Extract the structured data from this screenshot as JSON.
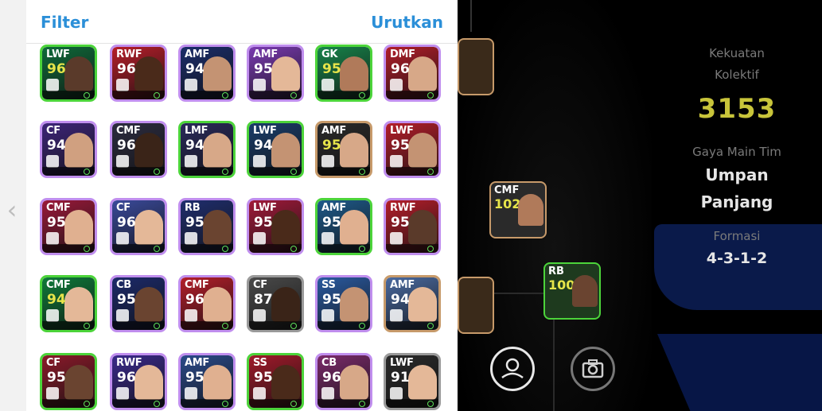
{
  "header": {
    "filter_label": "Filter",
    "sort_label": "Urutkan"
  },
  "players": [
    {
      "pos": "LWF",
      "rating": "96",
      "border": "#4cd43a",
      "bg": "#0f6a3a",
      "rc": "#e6e44a",
      "skin": "#5a3a2a"
    },
    {
      "pos": "RWF",
      "rating": "96",
      "border": "#c08eee",
      "bg": "#b61e2a",
      "rc": "#ffffff",
      "skin": "#4a2a1a"
    },
    {
      "pos": "AMF",
      "rating": "94",
      "border": "#c08eee",
      "bg": "#1b2d6a",
      "rc": "#ffffff",
      "skin": "#c49373"
    },
    {
      "pos": "AMF",
      "rating": "95",
      "border": "#c08eee",
      "bg": "#7a3ab0",
      "rc": "#ffffff",
      "skin": "#e4b898"
    },
    {
      "pos": "GK",
      "rating": "95",
      "border": "#4cd43a",
      "bg": "#17834a",
      "rc": "#e6e44a",
      "skin": "#b07a5a"
    },
    {
      "pos": "DMF",
      "rating": "96",
      "border": "#c08eee",
      "bg": "#b01e2a",
      "rc": "#ffffff",
      "skin": "#d7a888"
    },
    {
      "pos": "CF",
      "rating": "94",
      "border": "#c08eee",
      "bg": "#3d2578",
      "rc": "#ffffff",
      "skin": "#d0a080"
    },
    {
      "pos": "CMF",
      "rating": "96",
      "border": "#c08eee",
      "bg": "#2c2c40",
      "rc": "#ffffff",
      "skin": "#3a2418"
    },
    {
      "pos": "LMF",
      "rating": "94",
      "border": "#4cd43a",
      "bg": "#2a2a5a",
      "rc": "#ffffff",
      "skin": "#d7a888"
    },
    {
      "pos": "LWF",
      "rating": "94",
      "border": "#4cd43a",
      "bg": "#1a3d6a",
      "rc": "#ffffff",
      "skin": "#c49373"
    },
    {
      "pos": "AMF",
      "rating": "95",
      "border": "#c79a6a",
      "bg": "#2a2a2a",
      "rc": "#e6e44a",
      "skin": "#d7a888"
    },
    {
      "pos": "LWF",
      "rating": "95",
      "border": "#c08eee",
      "bg": "#b41e2a",
      "rc": "#ffffff",
      "skin": "#c49373"
    },
    {
      "pos": "CMF",
      "rating": "95",
      "border": "#c08eee",
      "bg": "#9a1a3a",
      "rc": "#ffffff",
      "skin": "#e0b090"
    },
    {
      "pos": "CF",
      "rating": "96",
      "border": "#c08eee",
      "bg": "#3a4a9a",
      "rc": "#ffffff",
      "skin": "#e4b898"
    },
    {
      "pos": "RB",
      "rating": "95",
      "border": "#c08eee",
      "bg": "#1f2e6e",
      "rc": "#ffffff",
      "skin": "#6a4430"
    },
    {
      "pos": "LWF",
      "rating": "95",
      "border": "#c08eee",
      "bg": "#a01a3a",
      "rc": "#ffffff",
      "skin": "#4a2a1a"
    },
    {
      "pos": "AMF",
      "rating": "95",
      "border": "#4cd43a",
      "bg": "#1e5a8a",
      "rc": "#ffffff",
      "skin": "#e0b090"
    },
    {
      "pos": "RWF",
      "rating": "95",
      "border": "#c08eee",
      "bg": "#b41e2a",
      "rc": "#ffffff",
      "skin": "#5a3a2a"
    },
    {
      "pos": "CMF",
      "rating": "94",
      "border": "#4cd43a",
      "bg": "#0f7a3a",
      "rc": "#e6e44a",
      "skin": "#e4b898"
    },
    {
      "pos": "CB",
      "rating": "95",
      "border": "#c08eee",
      "bg": "#1c2a6a",
      "rc": "#ffffff",
      "skin": "#6a4430"
    },
    {
      "pos": "CMF",
      "rating": "96",
      "border": "#c08eee",
      "bg": "#b41e2a",
      "rc": "#ffffff",
      "skin": "#e0b090"
    },
    {
      "pos": "CF",
      "rating": "87",
      "border": "#9a9a9a",
      "bg": "#4a4a4a",
      "rc": "#ffffff",
      "skin": "#3a2418"
    },
    {
      "pos": "SS",
      "rating": "95",
      "border": "#c08eee",
      "bg": "#2a5aa0",
      "rc": "#ffffff",
      "skin": "#c49373"
    },
    {
      "pos": "AMF",
      "rating": "94",
      "border": "#c79a6a",
      "bg": "#4a6aa0",
      "rc": "#ffffff",
      "skin": "#e4b898"
    },
    {
      "pos": "CF",
      "rating": "95",
      "border": "#4cd43a",
      "bg": "#8a1a2a",
      "rc": "#ffffff",
      "skin": "#6a4430"
    },
    {
      "pos": "RWF",
      "rating": "96",
      "border": "#c08eee",
      "bg": "#3a2a8a",
      "rc": "#ffffff",
      "skin": "#e4b898"
    },
    {
      "pos": "AMF",
      "rating": "95",
      "border": "#c08eee",
      "bg": "#2a4a8a",
      "rc": "#ffffff",
      "skin": "#e0b090"
    },
    {
      "pos": "SS",
      "rating": "95",
      "border": "#4cd43a",
      "bg": "#a01a2a",
      "rc": "#ffffff",
      "skin": "#4a2a1a"
    },
    {
      "pos": "CB",
      "rating": "96",
      "border": "#c08eee",
      "bg": "#7a2a6a",
      "rc": "#ffffff",
      "skin": "#d7a888"
    },
    {
      "pos": "LWF",
      "rating": "91",
      "border": "#9a9a9a",
      "bg": "#2a2a2a",
      "rc": "#ffffff",
      "skin": "#e4b898"
    }
  ],
  "pitch_cards": [
    {
      "pos": "CMF",
      "rating": "102",
      "border": "#c79a6a"
    },
    {
      "pos": "RB",
      "rating": "100",
      "border": "#4cd43a"
    }
  ],
  "stats": {
    "power_label_1": "Kekuatan",
    "power_label_2": "Kolektif",
    "power_value": "3153",
    "style_label": "Gaya Main Tim",
    "style_value_1": "Umpan",
    "style_value_2": "Panjang",
    "formation_label": "Formasi",
    "formation_value": "4-3-1-2"
  }
}
